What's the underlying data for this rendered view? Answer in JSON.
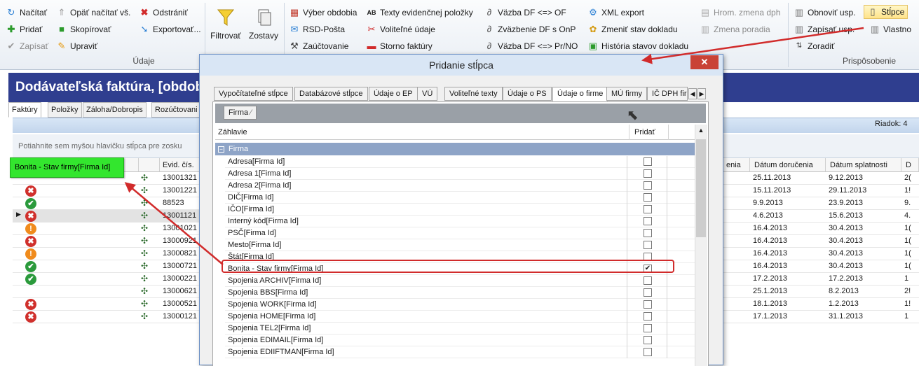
{
  "ribbon": {
    "col1": [
      "Načítať",
      "Pridať",
      "Zapísať"
    ],
    "col2": [
      "Opäť načítať vš.",
      "Skopírovať",
      "Upraviť"
    ],
    "col3": [
      "Odstrániť",
      "Exportovať..."
    ],
    "group_udaje": "Údaje",
    "filter_label": "Filtrovať",
    "reports_label": "Zostavy",
    "col4": [
      "Výber obdobia",
      "RSD-Pošta",
      "Zaúčtovanie"
    ],
    "col5": [
      "Texty evidenčnej položky",
      "Voliteľné údaje",
      "Storno faktúry"
    ],
    "col6": [
      "Väzba DF <=> OF",
      "Zväzbenie DF s OnP",
      "Väzba DF <=> Pr/NO"
    ],
    "col7": [
      "XML export",
      "Zmeniť stav dokladu",
      "História stavov dokladu"
    ],
    "col8": [
      "Hrom. zmena dph",
      "Zmena poradia"
    ],
    "col9": [
      "Obnoviť usp.",
      "Zapísať usp.",
      "Zoradiť"
    ],
    "stlpce": "Stĺpce",
    "vlastnosti": "Vlastno",
    "group_prisposobenie": "Prispôsobenie"
  },
  "app": {
    "title": "Dodávateľská faktúra, [obdob",
    "tabs": [
      "Faktúry",
      "Položky",
      "Záloha/Dobropis",
      "Rozúčtovani"
    ],
    "riadok": "Riadok: 4",
    "group_hint": "Potiahnite sem myšou hlavičku stĺpca pre zosku",
    "added_column": "Bonita - Stav firmy[Firma Id]",
    "col_evid": "Evid. čís.",
    "rows": [
      {
        "status": "",
        "evid": "13001321"
      },
      {
        "status": "err",
        "evid": "13001221"
      },
      {
        "status": "ok",
        "evid": "88523"
      },
      {
        "status": "err",
        "evid": "13001121",
        "selected": true
      },
      {
        "status": "warn",
        "evid": "13001021"
      },
      {
        "status": "err",
        "evid": "13000921"
      },
      {
        "status": "warn",
        "evid": "13000821"
      },
      {
        "status": "ok",
        "evid": "13000721"
      },
      {
        "status": "ok",
        "evid": "13000221"
      },
      {
        "status": "",
        "evid": "13000621"
      },
      {
        "status": "err",
        "evid": "13000521"
      },
      {
        "status": "err",
        "evid": "13000121"
      }
    ],
    "right_headers": [
      "enia",
      "Dátum doručenia",
      "Dátum splatnosti",
      "D"
    ],
    "right_rows": [
      [
        "25.11.2013",
        "9.12.2013",
        "2("
      ],
      [
        "15.11.2013",
        "29.11.2013",
        "1!"
      ],
      [
        "9.9.2013",
        "23.9.2013",
        "9."
      ],
      [
        "4.6.2013",
        "15.6.2013",
        "4."
      ],
      [
        "16.4.2013",
        "30.4.2013",
        "1("
      ],
      [
        "16.4.2013",
        "30.4.2013",
        "1("
      ],
      [
        "16.4.2013",
        "30.4.2013",
        "1("
      ],
      [
        "16.4.2013",
        "30.4.2013",
        "1("
      ],
      [
        "17.2.2013",
        "17.2.2013",
        "1"
      ],
      [
        "25.1.2013",
        "8.2.2013",
        "2!"
      ],
      [
        "18.1.2013",
        "1.2.2013",
        "1!"
      ],
      [
        "17.1.2013",
        "31.1.2013",
        "1"
      ]
    ]
  },
  "dialog": {
    "title": "Pridanie stĺpca",
    "close": "✕",
    "tabs": [
      "Vypočítateľné stĺpce",
      "Databázové stĺpce",
      "Údaje o EP",
      "VÚ",
      "Voliteľné texty",
      "Údaje o PS",
      "Údaje o firme",
      "MÚ firmy",
      "IČ DPH fir"
    ],
    "active_tab": 6,
    "group_chip": "Firma",
    "col_header": "Záhlavie",
    "col_add": "Pridať",
    "group_name": "Firma",
    "fields": [
      {
        "label": "Adresa[Firma Id]",
        "checked": false
      },
      {
        "label": "Adresa 1[Firma Id]",
        "checked": false
      },
      {
        "label": "Adresa 2[Firma Id]",
        "checked": false
      },
      {
        "label": "DIČ[Firma Id]",
        "checked": false
      },
      {
        "label": "IČO[Firma Id]",
        "checked": false
      },
      {
        "label": "Interný kód[Firma Id]",
        "checked": false
      },
      {
        "label": "PSČ[Firma Id]",
        "checked": false
      },
      {
        "label": "Mesto[Firma Id]",
        "checked": false
      },
      {
        "label": "Štát[Firma Id]",
        "checked": false
      },
      {
        "label": "Bonita - Stav firmy[Firma Id]",
        "checked": true
      },
      {
        "label": "Spojenia ARCHIV[Firma Id]",
        "checked": false
      },
      {
        "label": "Spojenia BBS[Firma Id]",
        "checked": false
      },
      {
        "label": "Spojenia WORK[Firma Id]",
        "checked": false
      },
      {
        "label": "Spojenia HOME[Firma Id]",
        "checked": false
      },
      {
        "label": "Spojenia TEL2[Firma Id]",
        "checked": false
      },
      {
        "label": "Spojenia EDIMAIL[Firma Id]",
        "checked": false
      },
      {
        "label": "Spojenia EDIIFTMAN[Firma Id]",
        "checked": false
      }
    ]
  },
  "colors": {
    "accent": "#2f3e8f",
    "highlight": "#d12b2b",
    "added": "#33e62e"
  }
}
